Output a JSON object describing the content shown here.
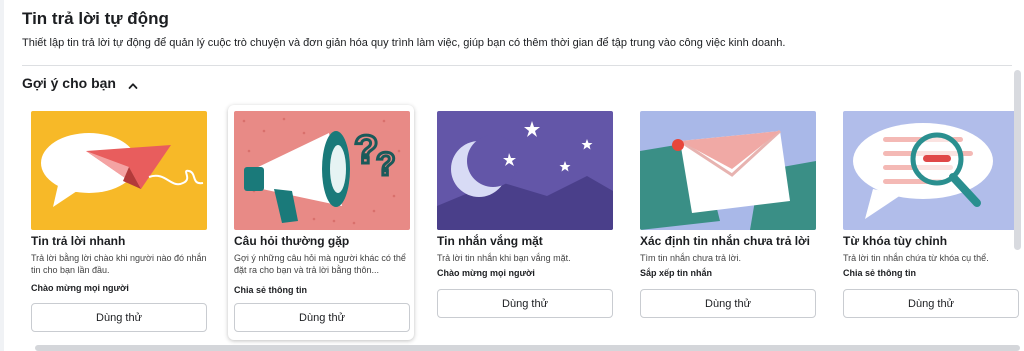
{
  "page": {
    "title": "Tin trả lời tự động",
    "description": "Thiết lập tin trả lời tự động để quản lý cuộc trò chuyện và đơn giản hóa quy trình làm việc, giúp bạn có thêm thời gian để tập trung vào công việc kinh doanh."
  },
  "section": {
    "title": "Gợi ý cho bạn",
    "expanded": true
  },
  "cards": [
    {
      "title": "Tin trả lời nhanh",
      "description": "Trả lời bằng lời chào khi người nào đó nhắn tin cho bạn lần đầu.",
      "tag": "Chào mừng mọi người",
      "button": "Dùng thử",
      "image": "paper-plane-speech-bubble",
      "bg": "#f7b928"
    },
    {
      "title": "Câu hỏi thường gặp",
      "description": "Gợi ý những câu hỏi mà người khác có thể đặt ra cho bạn và trả lời bằng thôn...",
      "tag": "Chia sẻ thông tin",
      "button": "Dùng thử",
      "image": "megaphone-question-marks",
      "bg": "#e88a86"
    },
    {
      "title": "Tin nhắn vắng mặt",
      "description": "Trả lời tin nhắn khi bạn vắng mặt.",
      "tag": "Chào mừng mọi người",
      "button": "Dùng thử",
      "image": "moon-stars-night",
      "bg": "#6356a8"
    },
    {
      "title": "Xác định tin nhắn chưa trả lời",
      "description": "Tìm tin nhắn chưa trả lời.",
      "tag": "Sắp xếp tin nhắn",
      "button": "Dùng thử",
      "image": "envelopes",
      "bg": "#a9b8e8"
    },
    {
      "title": "Từ khóa tùy chỉnh",
      "description": "Trả lời tin nhắn chứa từ khóa cụ thể.",
      "tag": "Chia sẻ thông tin",
      "button": "Dùng thử",
      "image": "magnifier-speech-bubble",
      "bg": "#b1bdea"
    }
  ]
}
